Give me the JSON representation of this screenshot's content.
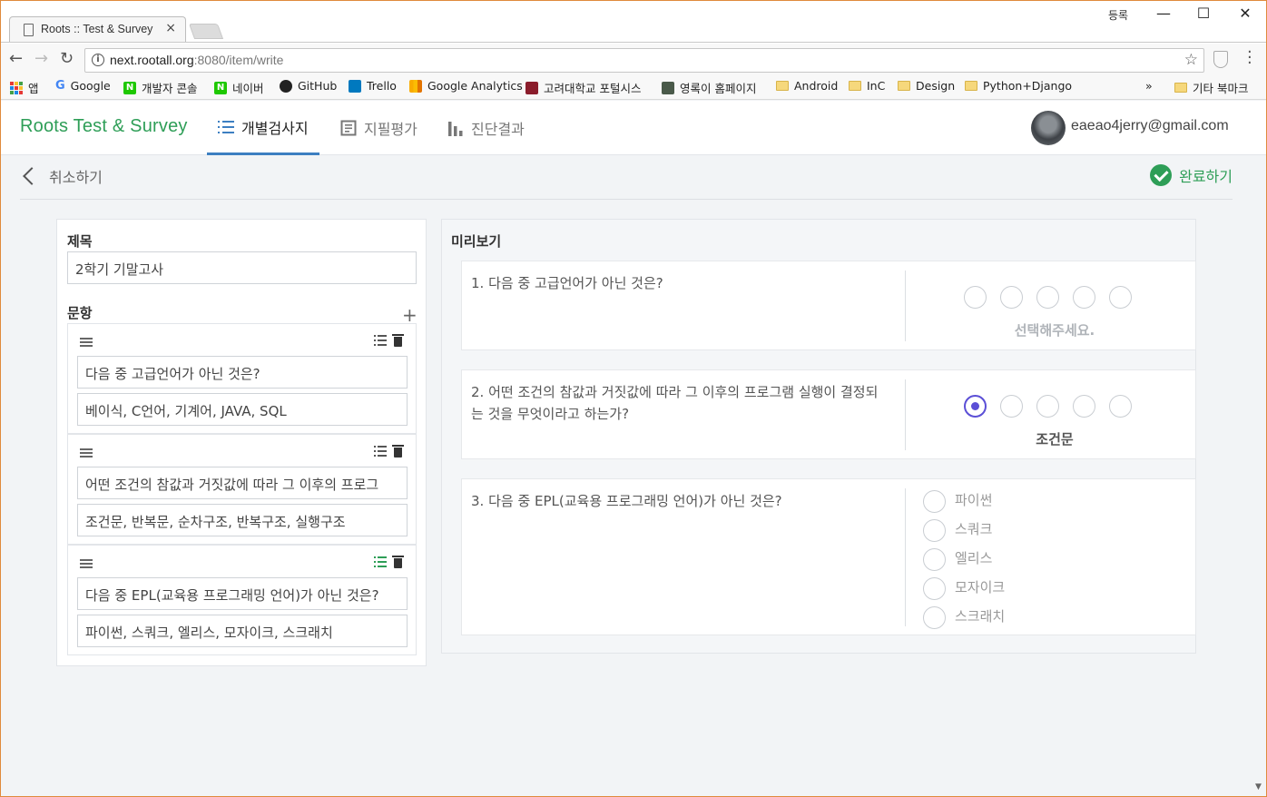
{
  "browser": {
    "tab_title": "Roots :: Test & Survey",
    "tab_close": "×",
    "window_user": "등록",
    "url_host": "next.rootall.org",
    "url_rest": ":8080/item/write",
    "info_glyph": "i",
    "bookmarks_overflow": "»",
    "bookmarks": [
      {
        "label": "앱",
        "icon": "apps-icon"
      },
      {
        "label": "Google",
        "icon": "google-icon"
      },
      {
        "label": "개발자 콘솔",
        "icon": "naver-icon"
      },
      {
        "label": "네이버",
        "icon": "naver-icon"
      },
      {
        "label": "GitHub",
        "icon": "github-icon"
      },
      {
        "label": "Trello",
        "icon": "trello-icon"
      },
      {
        "label": "Google Analytics",
        "icon": "analytics-icon"
      },
      {
        "label": "고려대학교 포털시스",
        "icon": "korea-univ-icon"
      },
      {
        "label": "영록이 홈페이지",
        "icon": "profile-icon"
      },
      {
        "label": "Android",
        "icon": "folder-icon"
      },
      {
        "label": "InC",
        "icon": "folder-icon"
      },
      {
        "label": "Design",
        "icon": "folder-icon"
      },
      {
        "label": "Python+Django",
        "icon": "folder-icon"
      },
      {
        "label": "기타 북마크",
        "icon": "folder-icon"
      }
    ]
  },
  "app": {
    "brand": "Roots Test & Survey",
    "nav": [
      {
        "label": "개별검사지",
        "icon": "list-numbered-icon",
        "active": true
      },
      {
        "label": "지필평가",
        "icon": "document-icon",
        "active": false
      },
      {
        "label": "진단결과",
        "icon": "bar-chart-icon",
        "active": false
      }
    ],
    "user_email": "eaeao4jerry@gmail.com",
    "cancel_label": "취소하기",
    "done_label": "완료하기",
    "colors": {
      "brand_green": "#2e9e57",
      "accent_blue": "#3d7fc1",
      "radio_purple": "#5b4fd6"
    }
  },
  "editor": {
    "title_label": "제목",
    "title_value": "2학기 기말고사",
    "items_label": "문항",
    "add_glyph": "+",
    "items": [
      {
        "question": "다음 중 고급언어가 아닌 것은?",
        "options": "베이식, C언어, 기계어, JAVA, SQL"
      },
      {
        "question": "어떤 조건의 참값과 거짓값에 따라 그 이후의 프로그",
        "options": "조건문, 반복문, 순차구조, 반복구조, 실행구조"
      },
      {
        "question": "다음 중 EPL(교육용 프로그래밍 언어)가 아닌 것은?",
        "options": "파이썬, 스쿼크, 엘리스, 모자이크, 스크래치"
      }
    ]
  },
  "preview": {
    "label": "미리보기",
    "q1": {
      "text": "1. 다음 중 고급언어가 아닌 것은?",
      "answer": "선택해주세요."
    },
    "q2": {
      "text": "2. 어떤 조건의 참값과 거짓값에 따라 그 이후의 프로그램 실행이 결정되는 것을 무엇이라고 하는가?",
      "answer": "조건문"
    },
    "q3": {
      "text": "3. 다음 중 EPL(교육용 프로그래밍 언어)가 아닌 것은?",
      "options": [
        "파이썬",
        "스쿼크",
        "엘리스",
        "모자이크",
        "스크래치"
      ]
    }
  }
}
